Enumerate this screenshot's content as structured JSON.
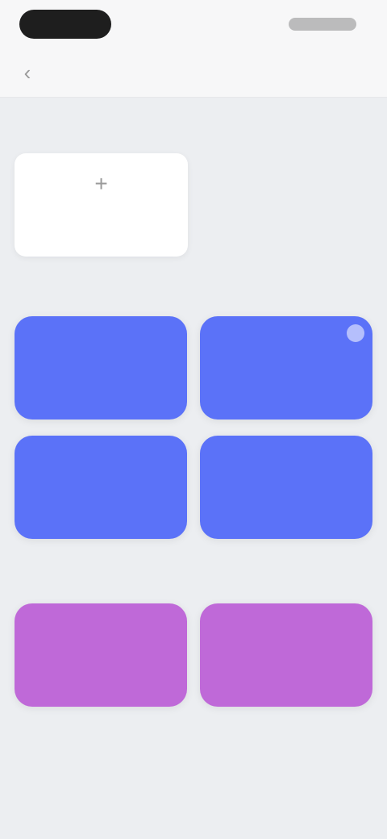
{
  "nav": {
    "title": "",
    "back_icon": "chevron-left-icon"
  },
  "sections": {
    "first": {
      "title": ""
    },
    "second": {
      "title": ""
    },
    "third": {
      "title": ""
    }
  },
  "add_card": {
    "plus": "+",
    "label": ""
  },
  "blue_cards": [
    {
      "name": "",
      "sub": ""
    },
    {
      "name": "",
      "sub": ""
    },
    {
      "name": "",
      "sub": ""
    },
    {
      "name": "",
      "sub": ""
    }
  ],
  "purple_cards": [
    {
      "name": "",
      "sub": ""
    },
    {
      "name": "",
      "sub": ""
    }
  ],
  "colors": {
    "background": "#eceef1",
    "blue": "#5b72f8",
    "purple": "#bf69d8"
  }
}
